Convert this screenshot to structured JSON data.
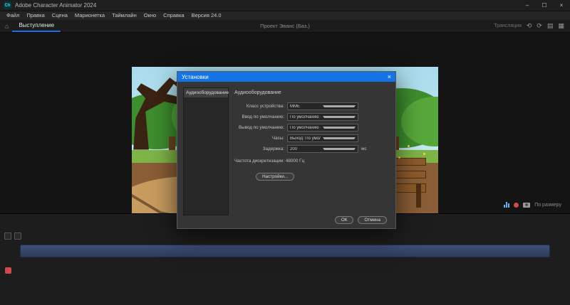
{
  "colors": {
    "accent": "#1473e6",
    "timeline-bar": "#3e5078",
    "record-red": "#cf4a4a"
  },
  "titlebar": {
    "icon_text": "Ch",
    "app_title": "Adobe Character Animator 2024",
    "minimize": "–",
    "maximize": "☐",
    "close": "×"
  },
  "menubar": {
    "items": [
      "Файл",
      "Правка",
      "Сцена",
      "Марионетка",
      "Таймлайн",
      "Окно",
      "Справка",
      "Версия 24.0"
    ]
  },
  "tabbar": {
    "home_icon": "⌂",
    "active_tab": "Выступление",
    "project_title": "Проект Эванс (Баз.)",
    "stream_label": "Трансляция",
    "undo_icon": "⟲",
    "redo_icon": "⟳",
    "panel_icon": "▤",
    "layout_icon": "▦"
  },
  "scene_tools": {
    "fit_label": "По размеру"
  },
  "dialog": {
    "title": "Установки",
    "close_icon": "×",
    "sidebar_items": [
      "Аудиооборудование"
    ],
    "heading": "Аудиооборудование",
    "rows": [
      {
        "label": "Класс устройства:",
        "value": "MME"
      },
      {
        "label": "Ввод по умолчанию:",
        "value": "По умолчанию - Микрофон (Realtek High Definition ..."
      },
      {
        "label": "Вывод по умолчанию:",
        "value": "По умолчанию - Динамики (Realtek High Definition ..."
      },
      {
        "label": "Часы:",
        "value": "Выход: По умолчанию - Динамики (Realtek High Def..."
      },
      {
        "label": "Задержка:",
        "value": "200",
        "suffix": "мс"
      }
    ],
    "sample_rate_label": "Частота дискретизации: 48000 Гц",
    "settings_button": "Настройки...",
    "ok_button": "ОК",
    "cancel_button": "Отмена"
  }
}
